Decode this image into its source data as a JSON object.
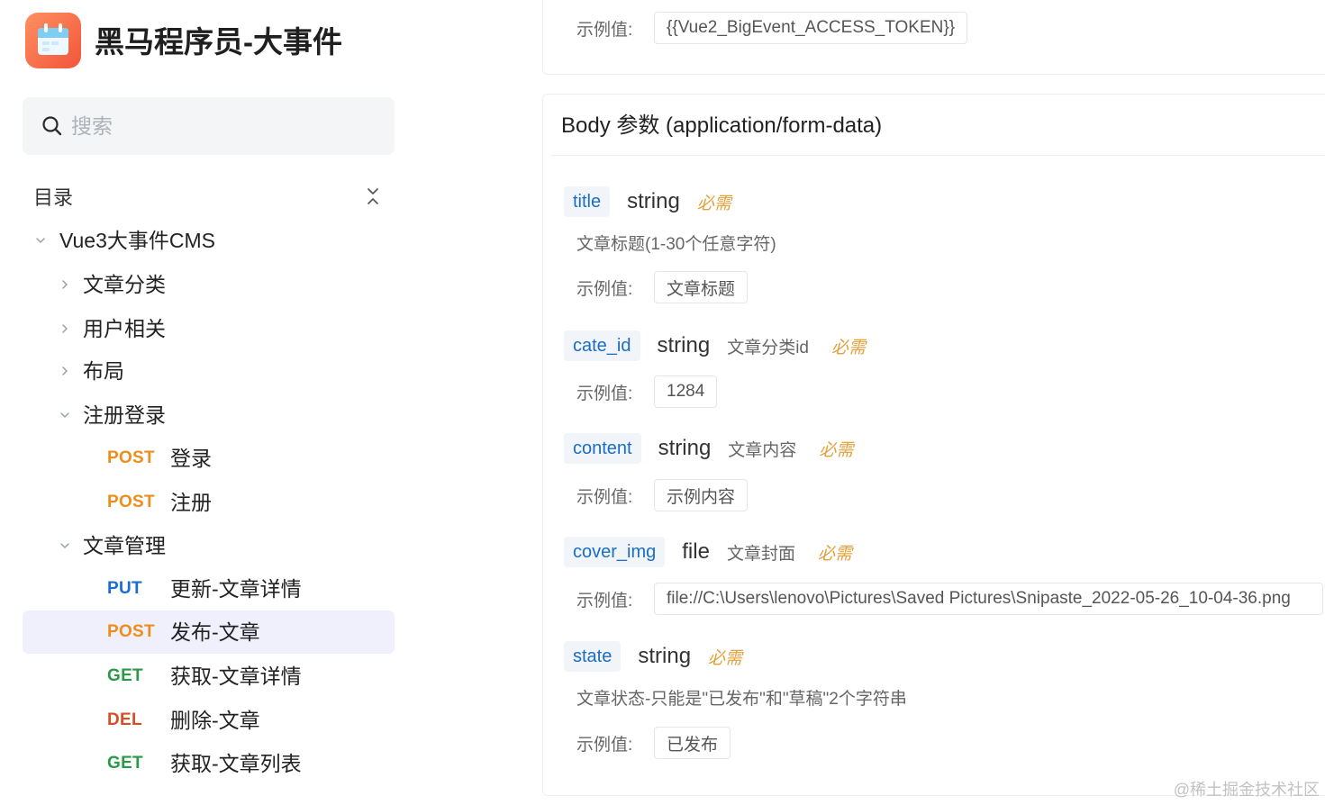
{
  "app": {
    "title": "黑马程序员-大事件",
    "logo_icon": "calendar-icon"
  },
  "search": {
    "icon": "search-icon",
    "placeholder": "搜索"
  },
  "toc": {
    "label": "目录",
    "collapse_icon": "collapse-all-icon"
  },
  "tree": {
    "root": {
      "label": "Vue3大事件CMS",
      "expanded": true
    },
    "folders": [
      {
        "label": "文章分类",
        "expanded": false,
        "endpoints": []
      },
      {
        "label": "用户相关",
        "expanded": false,
        "endpoints": []
      },
      {
        "label": "布局",
        "expanded": false,
        "endpoints": []
      },
      {
        "label": "注册登录",
        "expanded": true,
        "endpoints": [
          {
            "method": "POST",
            "label": "登录",
            "selected": false
          },
          {
            "method": "POST",
            "label": "注册",
            "selected": false
          }
        ]
      },
      {
        "label": "文章管理",
        "expanded": true,
        "endpoints": [
          {
            "method": "PUT",
            "label": "更新-文章详情",
            "selected": false
          },
          {
            "method": "POST",
            "label": "发布-文章",
            "selected": true
          },
          {
            "method": "GET",
            "label": "获取-文章详情",
            "selected": false
          },
          {
            "method": "DEL",
            "label": "删除-文章",
            "selected": false
          },
          {
            "method": "GET",
            "label": "获取-文章列表",
            "selected": false
          }
        ]
      }
    ]
  },
  "method_colors": {
    "POST": "#ef8d1c",
    "PUT": "#1b6dd2",
    "GET": "#2a9a46",
    "DEL": "#d94d22"
  },
  "colors": {
    "brand": "#f1553a",
    "selected_bg": "#f0f0fd",
    "param_name": "#1b6ec2",
    "param_name_bg": "#f1f4f9",
    "required": "#e2a03a",
    "muted_text": "#666666"
  },
  "header_params": {
    "example_label": "示例值:",
    "example_value": "{{Vue2_BigEvent_ACCESS_TOKEN}}"
  },
  "body": {
    "title": "Body 参数 (application/form-data)",
    "params": [
      {
        "name": "title",
        "type": "string",
        "required_label": "必需",
        "description": "文章标题(1-30个任意字符)",
        "example_label": "示例值:",
        "example": "文章标题"
      },
      {
        "name": "cate_id",
        "type": "string",
        "description": "文章分类id",
        "required_label": "必需",
        "example_label": "示例值:",
        "example": "1284"
      },
      {
        "name": "content",
        "type": "string",
        "description": "文章内容",
        "required_label": "必需",
        "example_label": "示例值:",
        "example": "示例内容"
      },
      {
        "name": "cover_img",
        "type": "file",
        "description": "文章封面",
        "required_label": "必需",
        "example_label": "示例值:",
        "example": "file://C:\\Users\\lenovo\\Pictures\\Saved Pictures\\Snipaste_2022-05-26_10-04-36.png"
      },
      {
        "name": "state",
        "type": "string",
        "required_label": "必需",
        "description": "文章状态-只能是\"已发布\"和\"草稿\"2个字符串",
        "example_label": "示例值:",
        "example": "已发布"
      }
    ]
  },
  "watermark": "@稀土掘金技术社区"
}
